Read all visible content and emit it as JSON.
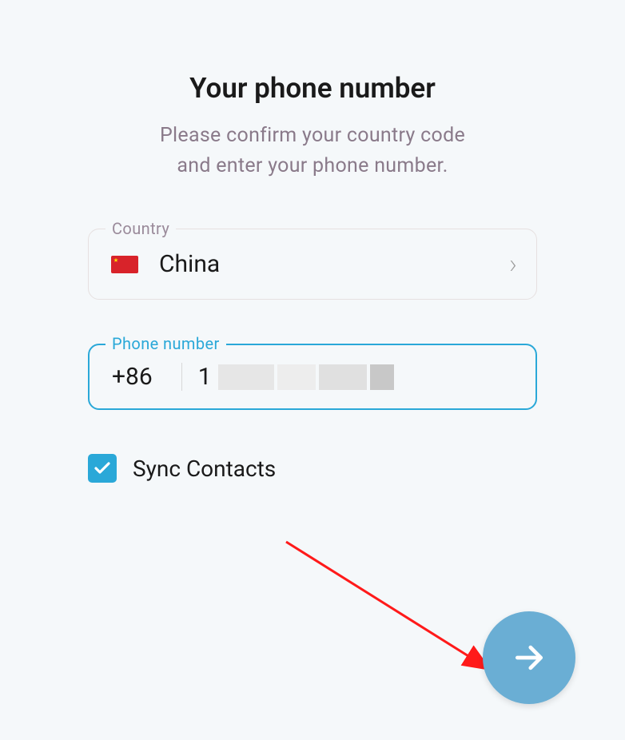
{
  "heading": {
    "title": "Your phone number",
    "subtitle_line1": "Please confirm your country code",
    "subtitle_line2": "and enter your phone number."
  },
  "country_field": {
    "label": "Country",
    "flag": "china-flag",
    "value": "China"
  },
  "phone_field": {
    "label": "Phone number",
    "code": "+86",
    "visible_digit": "1",
    "rest_redacted": true
  },
  "sync_contacts": {
    "label": "Sync Contacts",
    "checked": true
  },
  "colors": {
    "accent": "#2aa8d8",
    "fab": "#6aaed4"
  }
}
